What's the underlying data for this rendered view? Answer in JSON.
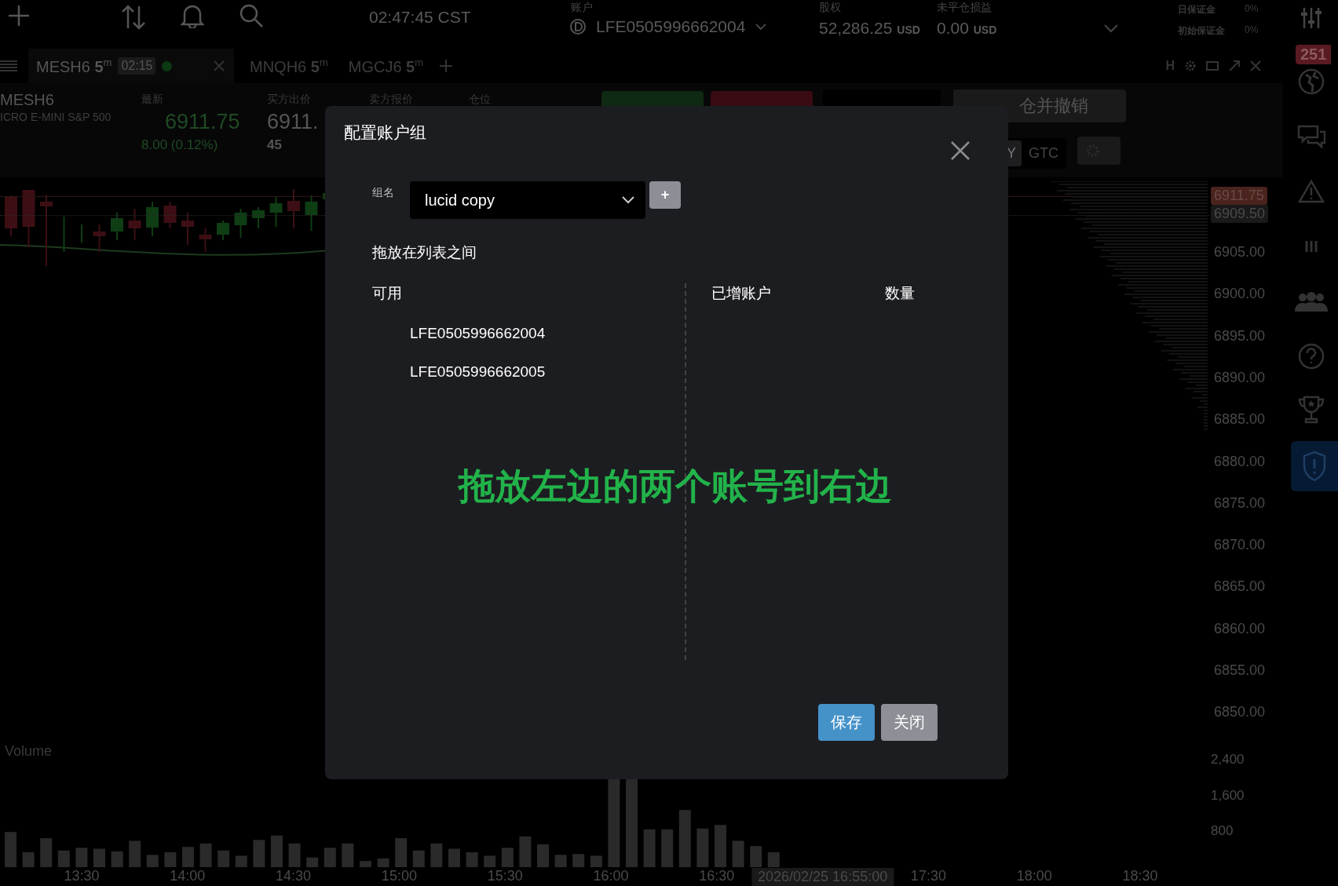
{
  "top_bar": {
    "clock": "02:47:45 CST",
    "account": {
      "label": "账户",
      "value": "LFE0505996662004"
    },
    "equity": {
      "label": "股权",
      "value": "52,286.25",
      "unit": "USD"
    },
    "unrealized": {
      "label": "未平仓损益",
      "value": "0.00",
      "unit": "USD"
    },
    "margins": [
      {
        "label": "日保证金",
        "value": "0%"
      },
      {
        "label": "初始保证金",
        "value": "0%"
      }
    ]
  },
  "tabs": [
    {
      "symbol": "MESH6",
      "interval": "5",
      "unit": "m",
      "timer": "02:15",
      "selected": true
    },
    {
      "symbol": "MNQH6",
      "interval": "5",
      "unit": "m",
      "selected": false
    },
    {
      "symbol": "MGCJ6",
      "interval": "5",
      "unit": "m",
      "selected": false
    }
  ],
  "window_controls": [
    "H"
  ],
  "sidebar": {
    "badge": "251",
    "items": [
      {
        "kind": "globe",
        "selected": false
      },
      {
        "kind": "chat",
        "selected": false
      },
      {
        "kind": "warning",
        "selected": false
      },
      {
        "kind": "bars",
        "selected": false
      },
      {
        "kind": "people",
        "selected": false
      },
      {
        "kind": "help",
        "selected": false
      },
      {
        "kind": "trophy",
        "selected": false
      },
      {
        "kind": "shield",
        "selected": true
      }
    ]
  },
  "quote": {
    "symbol": "MESH6",
    "name": "ICRO E-MINI S&P 500",
    "columns": [
      {
        "label": "最新",
        "value": "6911.75",
        "sub": "8.00 (0.12%)",
        "kind": "last"
      },
      {
        "label": "买方出价",
        "value": "6911.",
        "sub": "45",
        "kind": "bid"
      },
      {
        "label": "卖方报价",
        "kind": "ask"
      },
      {
        "label": "仓位",
        "kind": "position"
      }
    ]
  },
  "order_panel": {
    "flatten_button": "仓并撤销",
    "tif": [
      {
        "label": "Y",
        "selected": true
      },
      {
        "label": "GTC",
        "selected": false
      }
    ]
  },
  "chart": {
    "price_labels": [
      {
        "text": "6911.75",
        "kind": "last"
      },
      {
        "text": "6909.50",
        "kind": "marker"
      },
      {
        "text": "6905.00",
        "kind": "tick"
      },
      {
        "text": "6900.00",
        "kind": "tick"
      },
      {
        "text": "6895.00",
        "kind": "tick"
      },
      {
        "text": "6890.00",
        "kind": "tick"
      },
      {
        "text": "6885.00",
        "kind": "tick"
      },
      {
        "text": "6880.00",
        "kind": "tick"
      },
      {
        "text": "6875.00",
        "kind": "tick"
      },
      {
        "text": "6870.00",
        "kind": "tick"
      },
      {
        "text": "6865.00",
        "kind": "tick"
      },
      {
        "text": "6860.00",
        "kind": "tick"
      },
      {
        "text": "6855.00",
        "kind": "tick"
      },
      {
        "text": "6850.00",
        "kind": "tick"
      }
    ],
    "volume_label": "Volume",
    "volume_ticks": [
      "2,400",
      "1,600",
      "800"
    ],
    "time_labels": [
      {
        "text": "13:30",
        "kind": "tick"
      },
      {
        "text": "14:00",
        "kind": "tick"
      },
      {
        "text": "14:30",
        "kind": "tick"
      },
      {
        "text": "15:00",
        "kind": "tick"
      },
      {
        "text": "15:30",
        "kind": "tick"
      },
      {
        "text": "16:00",
        "kind": "tick"
      },
      {
        "text": "16:30",
        "kind": "tick"
      },
      {
        "text": "2026/02/25 16:55:00",
        "kind": "cursor"
      },
      {
        "text": "17:30",
        "kind": "tick"
      },
      {
        "text": "18:00",
        "kind": "tick"
      },
      {
        "text": "18:30",
        "kind": "tick"
      }
    ]
  },
  "dialog": {
    "title": "配置账户组",
    "group_label": "组名",
    "group_value": "lucid copy",
    "add_button": "+",
    "hint": "拖放在列表之间",
    "available": {
      "header": "可用",
      "items": [
        "LFE0505996662004",
        "LFE0505996662005"
      ]
    },
    "added": {
      "headers": [
        "已增账户",
        "数量"
      ]
    },
    "note": "拖放左边的两个账号到右边",
    "buttons": [
      {
        "label": "保存",
        "kind": "primary"
      },
      {
        "label": "关闭",
        "kind": "secondary"
      }
    ]
  }
}
